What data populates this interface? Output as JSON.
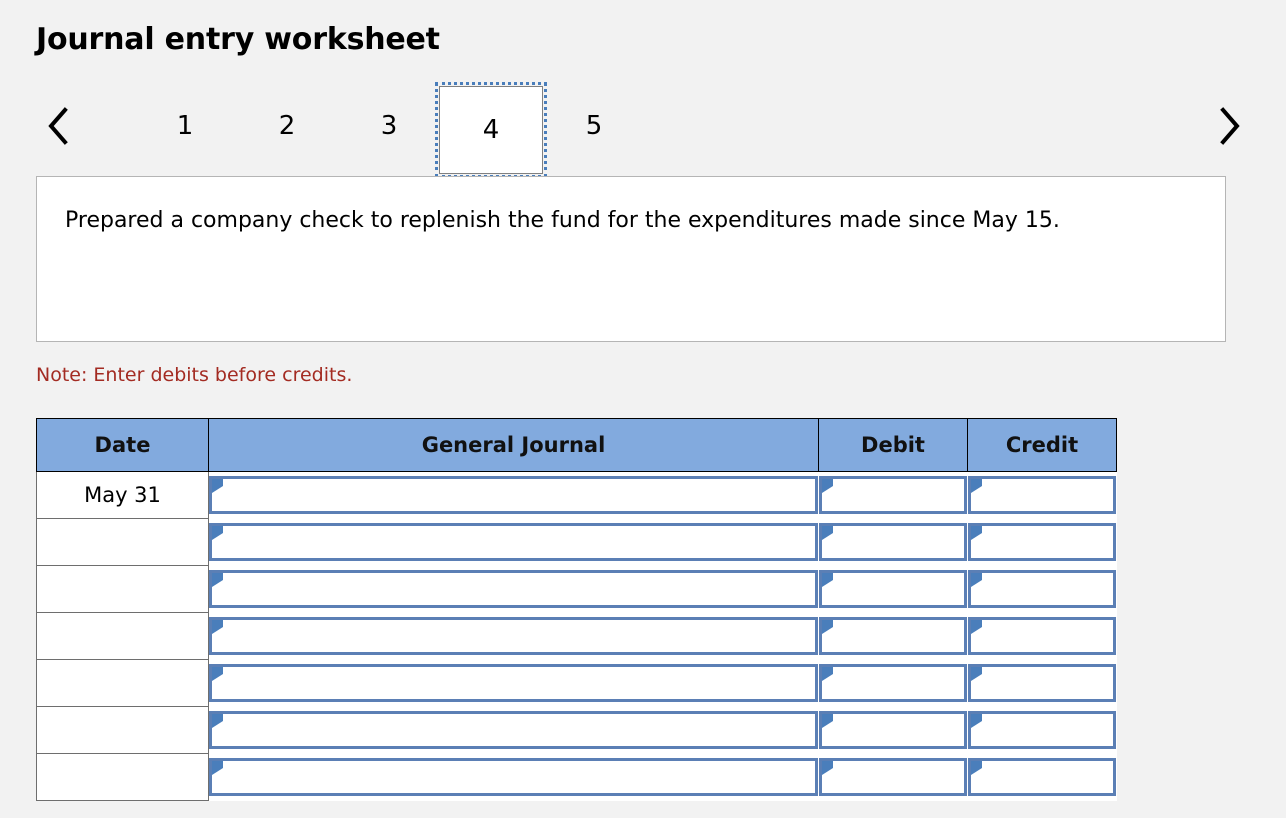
{
  "title": "Journal entry worksheet",
  "pager": {
    "prev_icon": "chevron-left-icon",
    "next_icon": "chevron-right-icon",
    "tabs": [
      {
        "label": "1",
        "active": false
      },
      {
        "label": "2",
        "active": false
      },
      {
        "label": "3",
        "active": false
      },
      {
        "label": "4",
        "active": true
      },
      {
        "label": "5",
        "active": false
      }
    ]
  },
  "question": {
    "text": "Prepared a company check to replenish the fund for the expenditures made since May 15."
  },
  "note": "Note: Enter debits before credits.",
  "table": {
    "headers": [
      "Date",
      "General Journal",
      "Debit",
      "Credit"
    ],
    "rows": [
      {
        "date": "May 31",
        "journal": "",
        "debit": "",
        "credit": ""
      },
      {
        "date": "",
        "journal": "",
        "debit": "",
        "credit": ""
      },
      {
        "date": "",
        "journal": "",
        "debit": "",
        "credit": ""
      },
      {
        "date": "",
        "journal": "",
        "debit": "",
        "credit": ""
      },
      {
        "date": "",
        "journal": "",
        "debit": "",
        "credit": ""
      },
      {
        "date": "",
        "journal": "",
        "debit": "",
        "credit": ""
      },
      {
        "date": "",
        "journal": "",
        "debit": "",
        "credit": ""
      }
    ]
  },
  "colors": {
    "header_blue": "#82aade",
    "field_border": "#5b7fb5",
    "caret_blue": "#4a7ebb",
    "note_red": "#a32b22",
    "page_bg": "#f2f2f2"
  }
}
